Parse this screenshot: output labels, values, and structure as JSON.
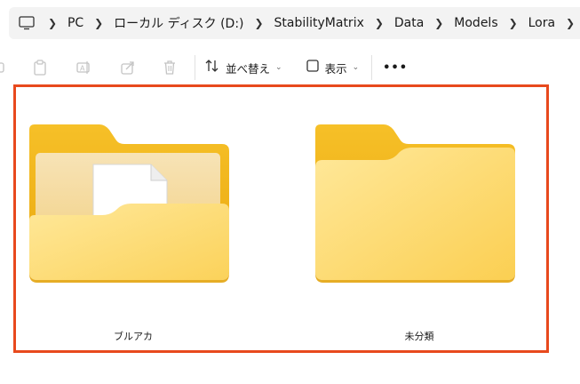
{
  "breadcrumb": [
    "PC",
    "ローカル ディスク (D:)",
    "StabilityMatrix",
    "Data",
    "Models",
    "Lora"
  ],
  "toolbar": {
    "sort_label": "並べ替え",
    "view_label": "表示",
    "more_label": "•••"
  },
  "folders": [
    {
      "name": "ブルアカ",
      "has_content": true
    },
    {
      "name": "未分類",
      "has_content": false
    }
  ],
  "colors": {
    "selection_border": "#e8491d",
    "folder_back": "#f2b21a",
    "folder_front": "#fdd86a"
  }
}
